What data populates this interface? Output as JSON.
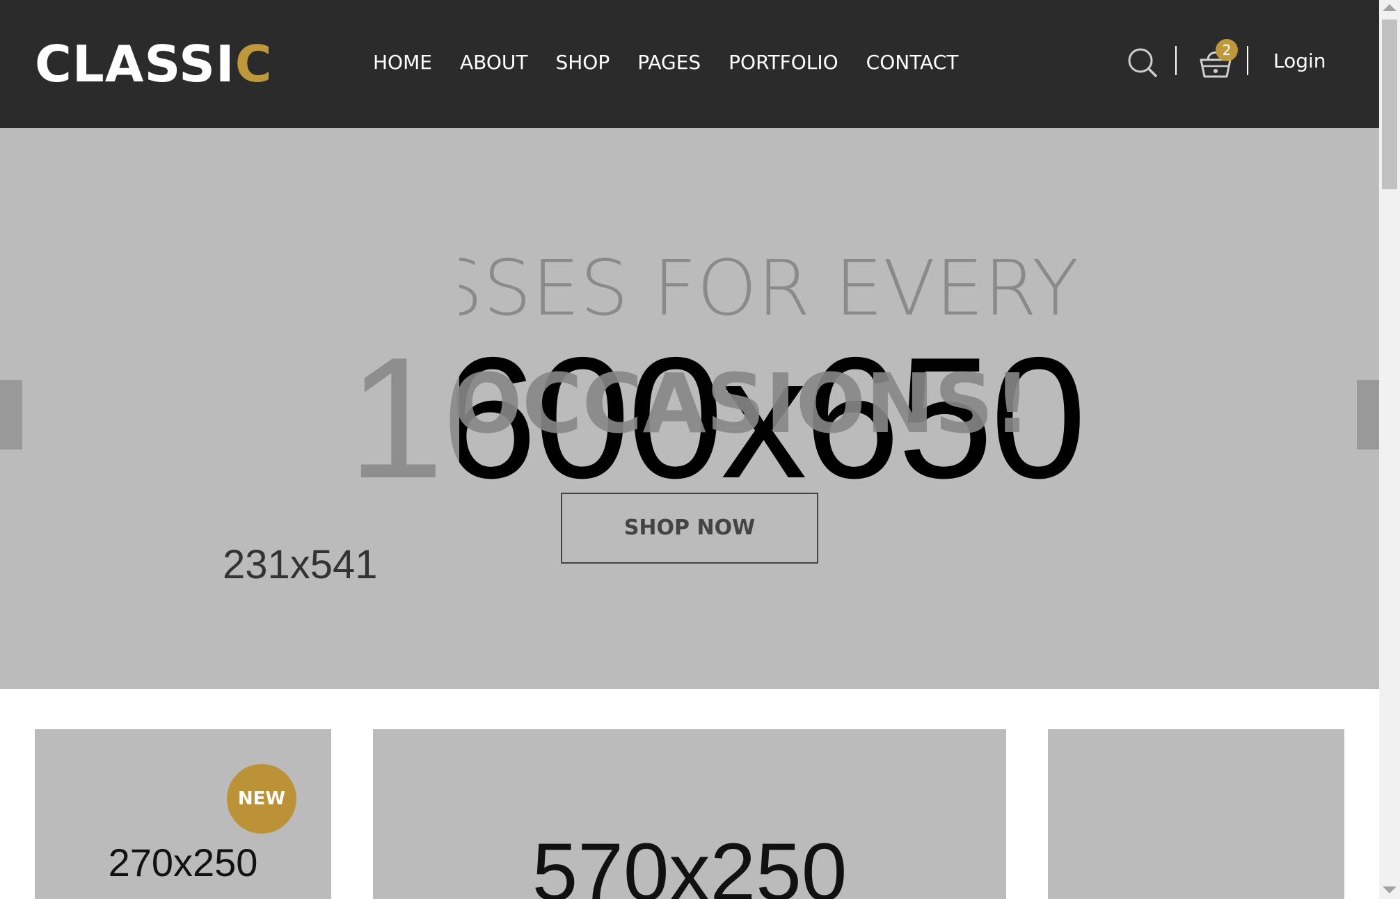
{
  "header": {
    "logo_main": "CLASSI",
    "logo_accent": "C",
    "nav": [
      "HOME",
      "ABOUT",
      "SHOP",
      "PAGES",
      "PORTFOLIO",
      "CONTACT"
    ],
    "cart_count": "2",
    "login_label": "Login",
    "search_icon": "search-icon",
    "cart_icon": "basket-icon"
  },
  "hero": {
    "placeholder_label": "1600x650",
    "headline": "GLASSES FOR EVERY",
    "subline": "OCCASIONS!",
    "side_image_label": "231x541",
    "shop_now_label": "SHOP NOW",
    "prev_icon": "arrow-left-icon",
    "next_icon": "arrow-right-icon"
  },
  "tiles": [
    {
      "label": "270x250",
      "badge": "NEW"
    },
    {
      "label": "570x250"
    },
    {
      "label": ""
    }
  ],
  "colors": {
    "header_bg": "#2b2b2b",
    "accent": "#c0983c",
    "placeholder_bg": "#bbbbbb"
  }
}
